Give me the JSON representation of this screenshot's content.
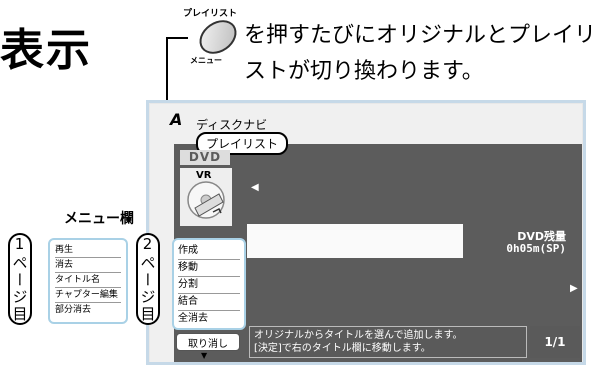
{
  "heading": {
    "text": "表示"
  },
  "instruction": {
    "button_top_label": "プレイリスト",
    "button_bottom_label": "メニュー",
    "line1": "を押すたびにオリジナルとプレイリ",
    "line2": "ストが切り換わります。"
  },
  "screen": {
    "disc_icon": "A",
    "nav_title": "ディスクナビ",
    "tab_label": "プレイリスト",
    "dvd_badge": "DVD",
    "vr_label": "VR",
    "remaining_label": "DVD残量",
    "remaining_value": "0h05m(SP)",
    "message_line1": "オリジナルからタイトルを選んで追加します。",
    "message_line2": "[決定]で右のタイトル欄に移動します。",
    "page_indicator": "1/1",
    "arrow_left": "◀",
    "arrow_right": "▶",
    "cancel_label": "取り消し",
    "down_arrow": "▼"
  },
  "menu_column": {
    "title": "メニュー欄",
    "page1_label": "1ページ目",
    "page2_label": "2ページ目",
    "page1_items": [
      "再生",
      "消去",
      "タイトル名",
      "チャプター編集",
      "部分消去"
    ],
    "page2_items": [
      "作成",
      "移動",
      "分割",
      "結合",
      "全消去"
    ]
  }
}
